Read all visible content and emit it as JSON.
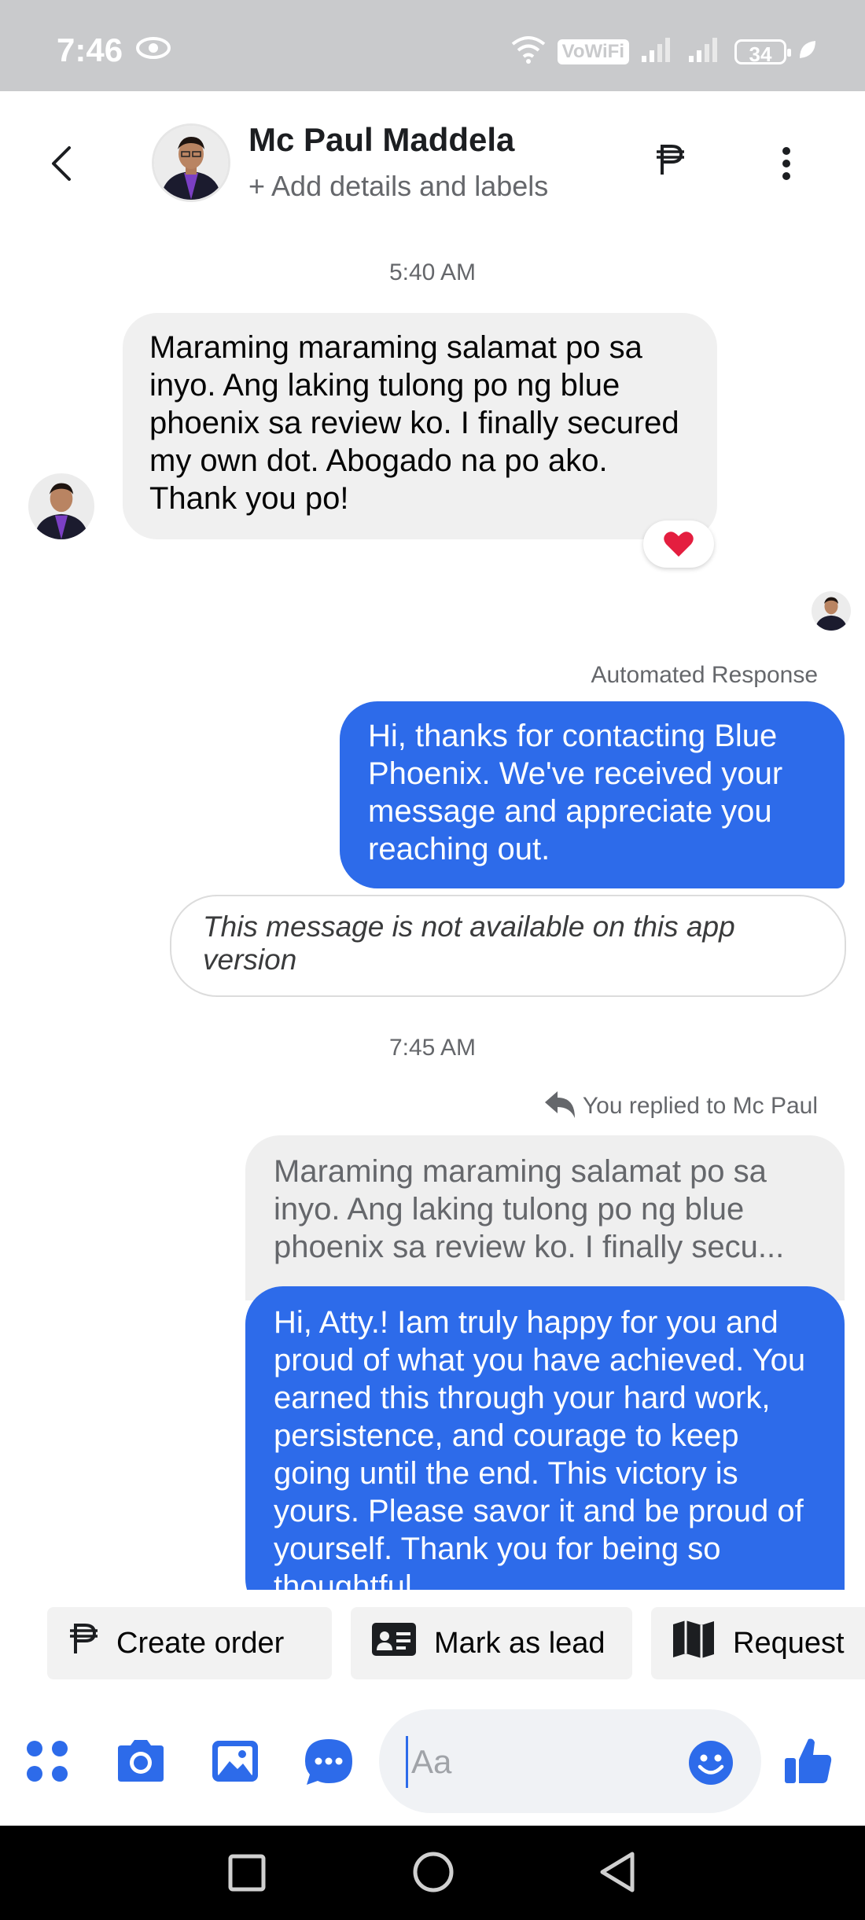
{
  "status_bar": {
    "time": "7:46",
    "vowifi": "VoWiFi",
    "battery": "34"
  },
  "header": {
    "contact_name": "Mc Paul Maddela",
    "subtitle": "+ Add details and labels"
  },
  "messages": {
    "timestamp_1": "5:40 AM",
    "incoming_1": "Maraming maraming salamat po sa inyo. Ang laking tulong po ng blue phoenix sa review ko. I finally secured my own dot. Abogado na po ako. Thank you po!",
    "reaction": "❤️",
    "automated_label": "Automated Response",
    "outgoing_1": "Hi, thanks for contacting Blue Phoenix. We've received your message and appreciate you reaching out.",
    "unavailable_notice": "This message is not available on this app version",
    "timestamp_2": "7:45 AM",
    "replied_label": "You replied to Mc Paul",
    "quoted_line_1": "Maraming maraming salamat po sa",
    "quoted_line_2": "inyo. Ang laking tulong po ng blue",
    "quoted_line_3": "phoenix sa review ko. I finally secu...",
    "outgoing_2": "Hi, Atty.! Iam truly happy for you and proud of what you have achieved. You earned this through your hard work, persistence, and courage to keep going until the end. This victory is yours. Please savor it and be proud of yourself. Thank you for being so thoughtful"
  },
  "quick_actions": {
    "create_order": "Create order",
    "mark_as_lead": "Mark as lead",
    "request": "Request"
  },
  "composer": {
    "placeholder": "Aa"
  },
  "colors": {
    "accent": "#2d6bea",
    "incoming_bubble": "#f0f0f0",
    "status_bar": "#c9cacc",
    "reaction_heart": "#e41e3f"
  },
  "icons": {
    "back": "chevron-left-icon",
    "peso": "peso-icon",
    "more": "more-vertical-icon",
    "apps": "apps-icon",
    "camera": "camera-icon",
    "gallery": "image-icon",
    "chat": "chat-bubble-icon",
    "emoji": "emoji-icon",
    "like": "thumbs-up-icon"
  }
}
